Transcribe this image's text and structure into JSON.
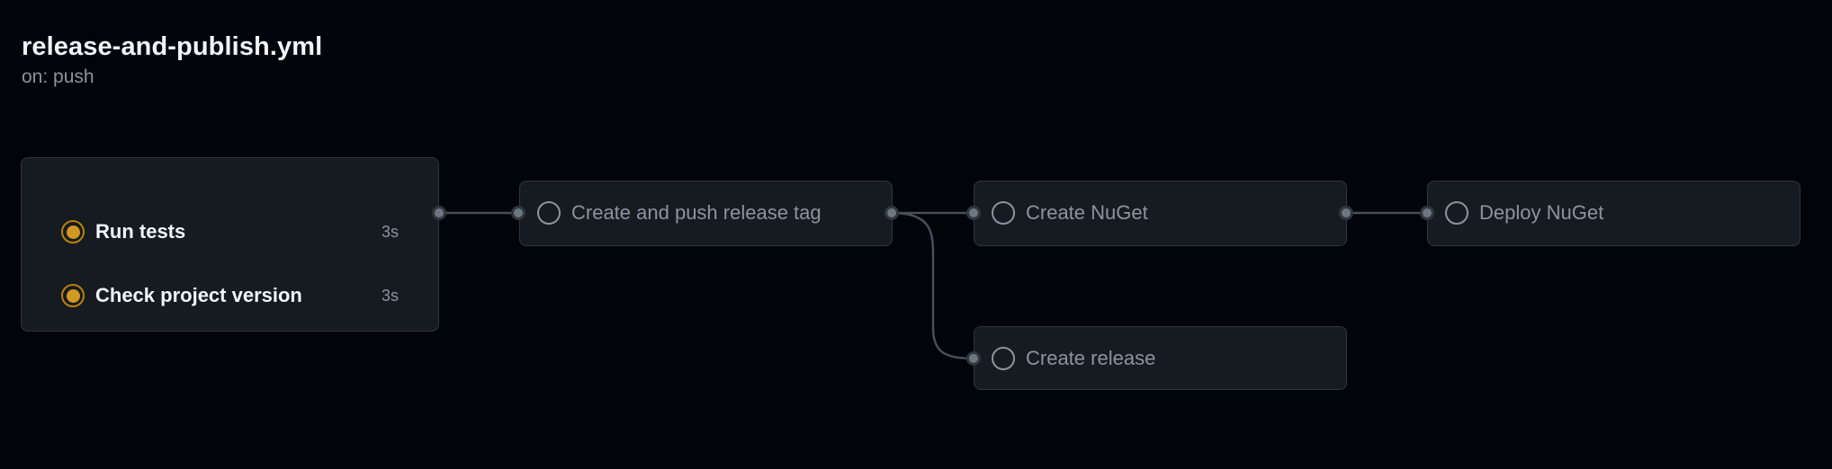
{
  "workflow": {
    "title": "release-and-publish.yml",
    "trigger": "on: push"
  },
  "colors": {
    "background": "#010409",
    "card": "#161b22",
    "border": "#30363d",
    "connector": "#484f58",
    "running": "#d29922",
    "pending": "#8b949e"
  },
  "group1": {
    "jobs": [
      {
        "name": "Run tests",
        "duration": "3s",
        "status": "in-progress",
        "icon": "in-progress-icon"
      },
      {
        "name": "Check project version",
        "duration": "3s",
        "status": "in-progress",
        "icon": "in-progress-icon"
      }
    ]
  },
  "jobs": {
    "create_tag": {
      "name": "Create and push release tag",
      "status": "queued",
      "icon": "queued-icon"
    },
    "create_nuget": {
      "name": "Create NuGet",
      "status": "queued",
      "icon": "queued-icon"
    },
    "deploy_nuget": {
      "name": "Deploy NuGet",
      "status": "queued",
      "icon": "queued-icon"
    },
    "create_release": {
      "name": "Create release",
      "status": "queued",
      "icon": "queued-icon"
    }
  }
}
